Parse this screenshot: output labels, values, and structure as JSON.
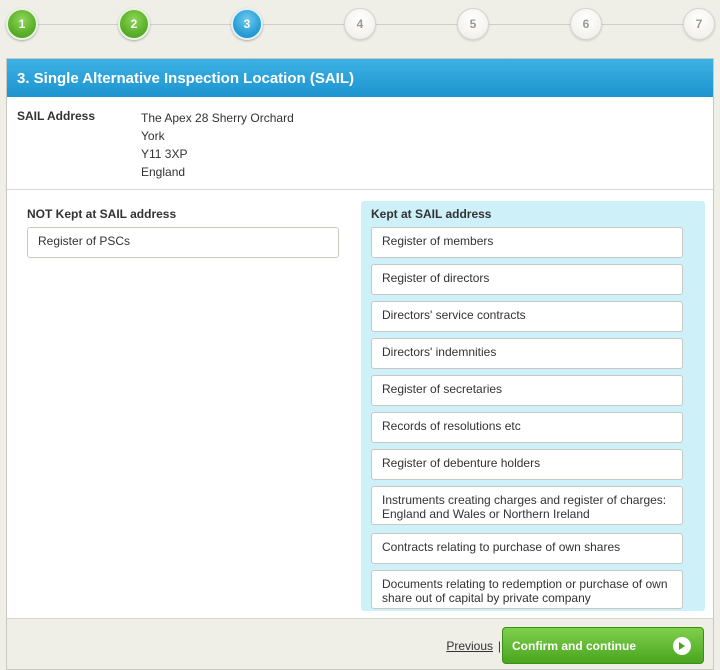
{
  "stepper": {
    "steps": [
      {
        "label": "1",
        "state": "done"
      },
      {
        "label": "2",
        "state": "done"
      },
      {
        "label": "3",
        "state": "active"
      },
      {
        "label": "4",
        "state": "todo"
      },
      {
        "label": "5",
        "state": "todo"
      },
      {
        "label": "6",
        "state": "todo"
      },
      {
        "label": "7",
        "state": "todo"
      }
    ]
  },
  "panel": {
    "title": "3. Single Alternative Inspection Location (SAIL)",
    "sail_label": "SAIL Address",
    "sail_address": [
      "The Apex 28 Sherry Orchard",
      "York",
      "Y11 3XP",
      "England"
    ]
  },
  "not_kept": {
    "title": "NOT Kept at SAIL address",
    "items": [
      "Register of PSCs"
    ]
  },
  "kept": {
    "title": "Kept at SAIL address",
    "items": [
      "Register of members",
      "Register of directors",
      "Directors' service contracts",
      "Directors' indemnities",
      "Register of secretaries",
      "Records of resolutions etc",
      "Register of debenture holders",
      "Instruments creating charges and register of charges: England and Wales or Northern Ireland",
      "Contracts relating to purchase of own shares",
      "Documents relating to redemption or purchase of own share out of capital by private company"
    ]
  },
  "footer": {
    "previous_label": "Previous",
    "separator": "|",
    "confirm_label": "Confirm and continue"
  },
  "colors": {
    "header_blue": "#1e94cf",
    "step_done": "#5cb02a",
    "step_active": "#2a9fd6",
    "kept_bg": "#cdf0f9",
    "confirm_green": "#4aa51f"
  }
}
